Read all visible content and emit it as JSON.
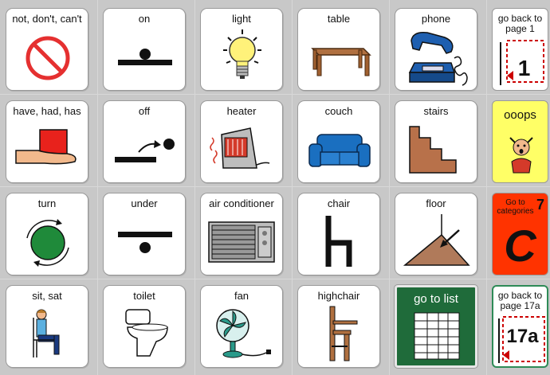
{
  "cells": {
    "not_dont_cant": "not, don't, can't",
    "on": "on",
    "light": "light",
    "table": "table",
    "phone": "phone",
    "have_had_has": "have, had, has",
    "off": "off",
    "heater": "heater",
    "couch": "couch",
    "stairs": "stairs",
    "turn": "turn",
    "under": "under",
    "air_conditioner": "air conditioner",
    "chair": "chair",
    "floor": "floor",
    "sit_sat": "sit,  sat",
    "toilet": "toilet",
    "fan": "fan",
    "highchair": "highchair",
    "go_to_list": "go to list"
  },
  "nav": {
    "back_page1_line1": "go back to",
    "back_page1_line2": "page 1",
    "back_page1_num": "1",
    "ooops": "ooops",
    "categories_line1": "Go to",
    "categories_line2": "categories",
    "categories_num": "7",
    "categories_letter": "C",
    "back_17a_line1": "go back to",
    "back_17a_line2": "page 17a",
    "back_17a_num": "17a"
  },
  "colors": {
    "background": "#c8c8c8",
    "ooops_bg": "#ffff66",
    "categories_bg": "#ff3300",
    "go_to_list_bg": "#1f6b3a",
    "back_border_green": "#2e8b57"
  }
}
